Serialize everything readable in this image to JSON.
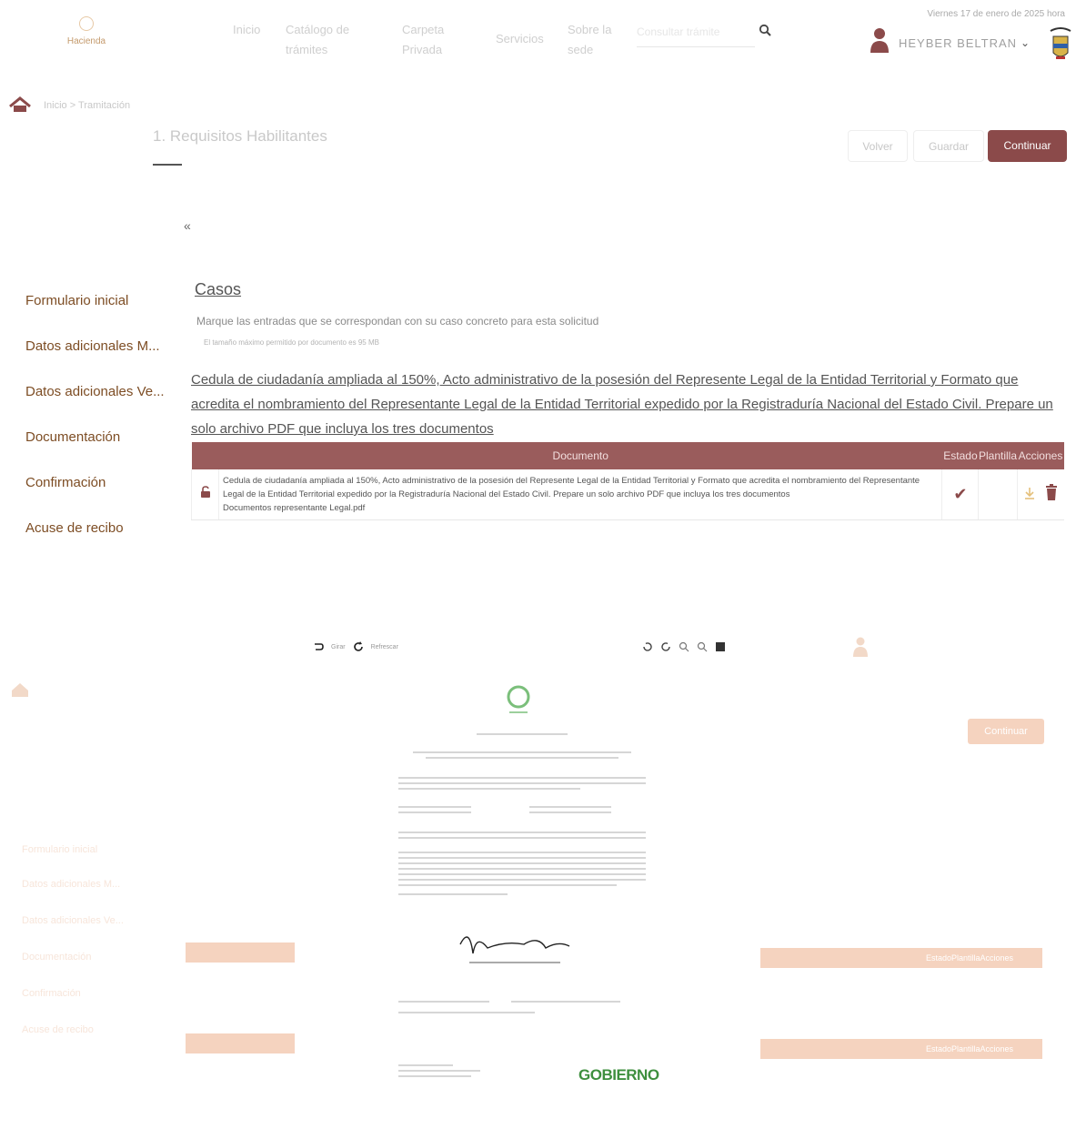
{
  "header": {
    "logo_text": "Hacienda",
    "nav": [
      "Inicio",
      "Catálogo de trámites",
      "Carpeta Privada",
      "Servicios",
      "Sobre la sede"
    ],
    "search_placeholder": "Consultar trámite",
    "date_text": "Viernes 17 de enero de 2025 hora",
    "user_name": "HEYBER BELTRAN"
  },
  "breadcrumb": {
    "text": "Inicio  >  Tramitación"
  },
  "page": {
    "title": "1. Requisitos Habilitantes",
    "buttons": {
      "back": "Volver",
      "save": "Guardar",
      "continue": "Continuar"
    },
    "collapse_glyph": "«"
  },
  "sidebar": {
    "items": [
      "Formulario inicial",
      "Datos adicionales M...",
      "Datos adicionales Ve...",
      "Documentación",
      "Confirmación",
      "Acuse de recibo"
    ]
  },
  "cases": {
    "title": "Casos",
    "help": "Marque las entradas que se correspondan con su caso concreto para esta solicitud",
    "note": "El tamaño máximo permitido por documento es 95 MB",
    "doc_heading": "Cedula de ciudadanía ampliada al 150%, Acto administrativo de la posesión del Represente Legal de la Entidad Territorial y Formato que acredita el nombramiento del Representante Legal de la Entidad Territorial expedido por la Registraduría Nacional del Estado Civil. Prepare un solo archivo PDF que incluya los tres documentos",
    "table": {
      "headers": {
        "documento": "Documento",
        "estado": "Estado",
        "plantilla": "Plantilla",
        "acciones": "Acciones"
      },
      "row": {
        "description": "Cedula de ciudadanía ampliada al 150%, Acto administrativo de la posesión del Represente Legal de la Entidad Territorial y Formato que acredita el nombramiento del Representante Legal de la Entidad Territorial expedido por la Registraduría Nacional del Estado Civil. Prepare un solo archivo PDF que incluya los tres documentos",
        "file": "Documentos representante Legal.pdf",
        "status_glyph": "✔"
      }
    }
  },
  "viewer": {
    "toolbar": {
      "rotate_left": "Girar",
      "refresh": "Refrescar"
    },
    "ghost_continue": "Continuar",
    "ghost_header_label": "EstadoPlantillaAcciones",
    "ghost_sidebar": [
      "Formulario inicial",
      "Datos adicionales M...",
      "Datos adicionales Ve...",
      "Documentación",
      "Confirmación",
      "Acuse de recibo"
    ],
    "pdf": {
      "footer_brand": "GOBIERNO"
    }
  },
  "colors": {
    "brand": "#8b4a4a",
    "table_header": "#9a5c5c",
    "sidebar_text": "#7d4d24",
    "ghost_accent": "#f5d3bf"
  }
}
